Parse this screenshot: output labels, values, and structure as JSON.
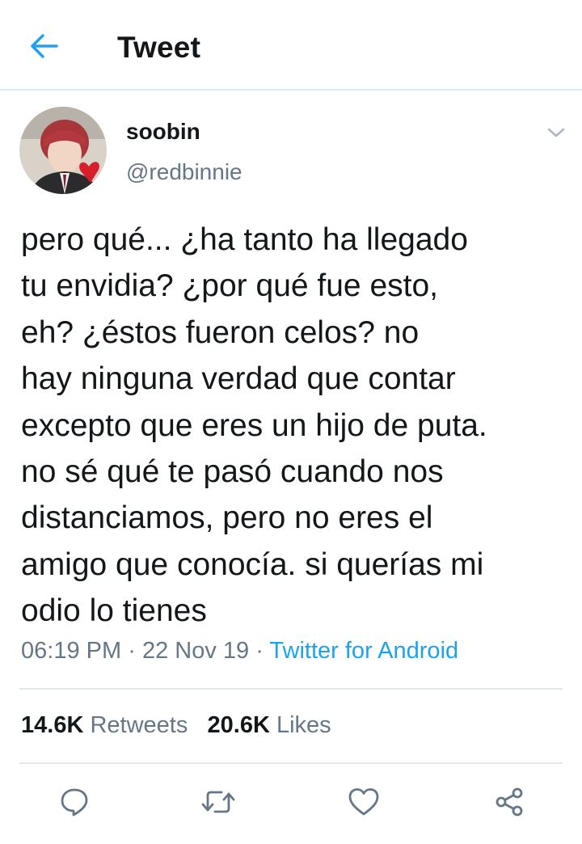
{
  "header": {
    "title": "Tweet",
    "back_icon": "back-arrow-icon",
    "accent_color": "#1da1f2"
  },
  "author": {
    "display_name": "soobin",
    "handle": "@redbinnie"
  },
  "tweet": {
    "lines": [
      "pero qué... ¿ha tanto ha llegado",
      "tu envidia? ¿por qué fue esto,",
      "eh? ¿éstos fueron celos? no",
      "hay ninguna verdad que contar",
      "excepto que eres un hijo de puta.",
      "no sé qué te pasó cuando nos",
      "distanciamos, pero no eres el",
      "amigo que conocía. si querías mi",
      "odio lo tienes"
    ],
    "time": "06:19 PM",
    "date": "22 Nov 19",
    "separator": "·",
    "source": "Twitter for Android"
  },
  "stats": {
    "retweets_count": "14.6K",
    "retweets_label": "Retweets",
    "likes_count": "20.6K",
    "likes_label": "Likes"
  },
  "actions": [
    {
      "name": "reply",
      "icon": "reply-bubble-icon"
    },
    {
      "name": "retweet",
      "icon": "retweet-arrows-icon"
    },
    {
      "name": "like",
      "icon": "heart-icon"
    },
    {
      "name": "share",
      "icon": "share-nodes-icon"
    }
  ],
  "colors": {
    "text": "#14171a",
    "secondary": "#657786",
    "link": "#1da1f2",
    "divider": "#e1e8ed"
  }
}
